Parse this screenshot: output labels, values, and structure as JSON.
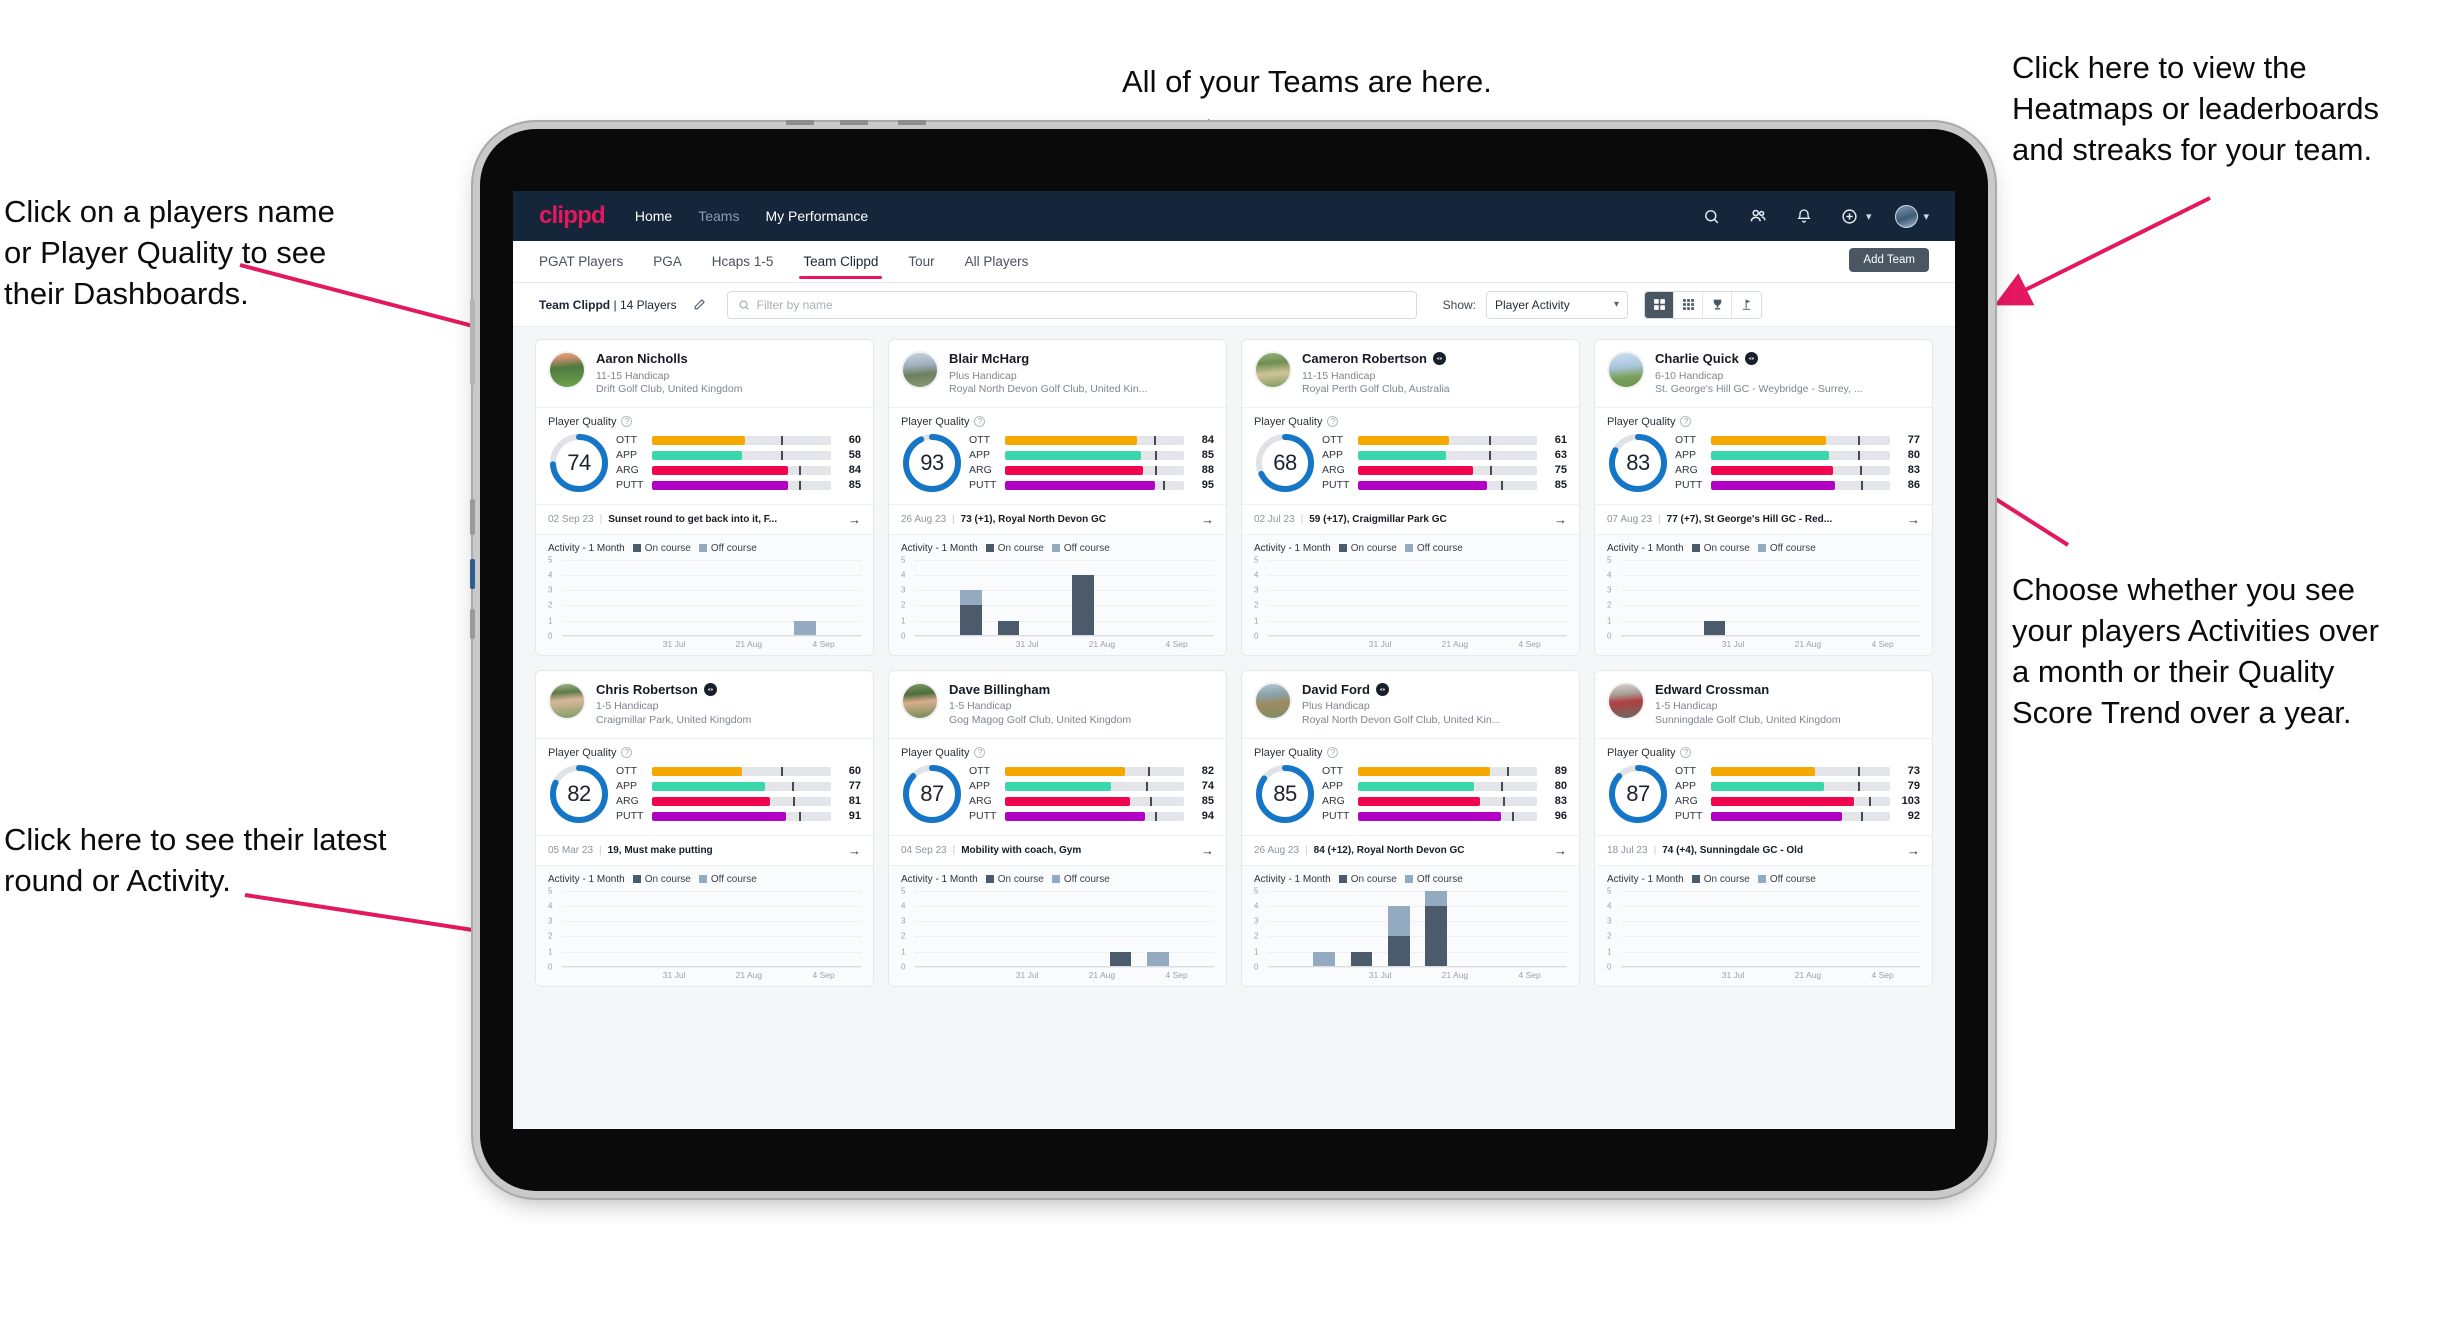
{
  "annotations": [
    {
      "id": "teams",
      "text": "All of your Teams are here."
    },
    {
      "id": "heatmaps",
      "text": "Click here to view the\nHeatmaps or leaderboards\nand streaks for your team."
    },
    {
      "id": "players-name",
      "text": "Click on a players name\nor Player Quality to see\ntheir Dashboards."
    },
    {
      "id": "choose-view",
      "text": "Choose whether you see\nyour players Activities over\na month or their Quality\nScore Trend over a year."
    },
    {
      "id": "latest-round",
      "text": "Click here to see their latest\nround or Activity."
    }
  ],
  "topnav": {
    "brand": "clippd",
    "links": [
      {
        "label": "Home",
        "active": true
      },
      {
        "label": "Teams",
        "active": false
      },
      {
        "label": "My Performance",
        "active": true
      }
    ],
    "icons": [
      "search-icon",
      "people-icon",
      "bell-icon",
      "plus-circle-icon"
    ],
    "avatar": "user-avatar"
  },
  "tabs": [
    {
      "label": "PGAT Players",
      "active": false
    },
    {
      "label": "PGA",
      "active": false
    },
    {
      "label": "Hcaps 1-5",
      "active": false
    },
    {
      "label": "Team Clippd",
      "active": true
    },
    {
      "label": "Tour",
      "active": false
    },
    {
      "label": "All Players",
      "active": false
    }
  ],
  "add_team_label": "Add Team",
  "toolbar": {
    "team_name": "Team Clippd",
    "team_count": "14 Players",
    "separator": "|",
    "edit_icon": "pencil-icon",
    "search_placeholder": "Filter by name",
    "search_value": "",
    "show_label": "Show:",
    "show_value": "Player Activity",
    "views": [
      {
        "name": "card-view-icon",
        "active": true
      },
      {
        "name": "table-view-icon",
        "active": false
      },
      {
        "name": "trophy-view-icon",
        "active": false
      },
      {
        "name": "flag-view-icon",
        "active": false
      }
    ]
  },
  "card_labels": {
    "quality_title": "Player Quality",
    "activity_title": "Activity - 1 Month",
    "legend_on": "On course",
    "legend_off": "Off course",
    "metric_names": [
      "OTT",
      "APP",
      "ARG",
      "PUTT"
    ],
    "x_ticks": [
      "31 Jul",
      "21 Aug",
      "4 Sep"
    ],
    "y_ticks": [
      "5",
      "4",
      "3",
      "2",
      "1",
      "0"
    ]
  },
  "colors": {
    "accent": "#e4185f",
    "navy": "#15263a",
    "ring": "#1575c6",
    "ott": "#f5a800",
    "app": "#3ad6ac",
    "arg": "#f2054f",
    "putt": "#b300c7",
    "on_course": "#4b5b6b",
    "off_course": "#93aac0"
  },
  "players": [
    {
      "name": "Aaron Nicholls",
      "verified": false,
      "avatar": "av1",
      "handicap": "11-15 Handicap",
      "club": "Drift Golf Club, United Kingdom",
      "score": 74,
      "metrics": [
        {
          "label": "OTT",
          "value": 60,
          "fill": 52,
          "tick": 72
        },
        {
          "label": "APP",
          "value": 58,
          "fill": 50,
          "tick": 72
        },
        {
          "label": "ARG",
          "value": 84,
          "fill": 76,
          "tick": 82
        },
        {
          "label": "PUTT",
          "value": 85,
          "fill": 76,
          "tick": 82
        }
      ],
      "latest_date": "02 Sep 23",
      "latest_text": "Sunset round to get back into it, F...",
      "activity": [
        {
          "on": 0,
          "off": 0
        },
        {
          "on": 0,
          "off": 0
        },
        {
          "on": 0,
          "off": 0
        },
        {
          "on": 0,
          "off": 0
        },
        {
          "on": 0,
          "off": 0
        },
        {
          "on": 0,
          "off": 0
        },
        {
          "on": 0,
          "off": 1
        },
        {
          "on": 0,
          "off": 0
        }
      ]
    },
    {
      "name": "Blair McHarg",
      "verified": false,
      "avatar": "av2",
      "handicap": "Plus Handicap",
      "club": "Royal North Devon Golf Club, United Kin...",
      "score": 93,
      "metrics": [
        {
          "label": "OTT",
          "value": 84,
          "fill": 74,
          "tick": 83
        },
        {
          "label": "APP",
          "value": 85,
          "fill": 76,
          "tick": 84
        },
        {
          "label": "ARG",
          "value": 88,
          "fill": 77,
          "tick": 84
        },
        {
          "label": "PUTT",
          "value": 95,
          "fill": 84,
          "tick": 88
        }
      ],
      "latest_date": "26 Aug 23",
      "latest_text": "73 (+1), Royal North Devon GC",
      "activity": [
        {
          "on": 0,
          "off": 0
        },
        {
          "on": 2,
          "off": 1
        },
        {
          "on": 1,
          "off": 0
        },
        {
          "on": 0,
          "off": 0
        },
        {
          "on": 4,
          "off": 0
        },
        {
          "on": 0,
          "off": 0
        },
        {
          "on": 0,
          "off": 0
        },
        {
          "on": 0,
          "off": 0
        }
      ]
    },
    {
      "name": "Cameron Robertson",
      "verified": true,
      "avatar": "av3",
      "handicap": "11-15 Handicap",
      "club": "Royal Perth Golf Club, Australia",
      "score": 68,
      "metrics": [
        {
          "label": "OTT",
          "value": 61,
          "fill": 51,
          "tick": 73
        },
        {
          "label": "APP",
          "value": 63,
          "fill": 49,
          "tick": 73
        },
        {
          "label": "ARG",
          "value": 75,
          "fill": 64,
          "tick": 74
        },
        {
          "label": "PUTT",
          "value": 85,
          "fill": 72,
          "tick": 80
        }
      ],
      "latest_date": "02 Jul 23",
      "latest_text": "59 (+17), Craigmillar Park GC",
      "activity": [
        {
          "on": 0,
          "off": 0
        },
        {
          "on": 0,
          "off": 0
        },
        {
          "on": 0,
          "off": 0
        },
        {
          "on": 0,
          "off": 0
        },
        {
          "on": 0,
          "off": 0
        },
        {
          "on": 0,
          "off": 0
        },
        {
          "on": 0,
          "off": 0
        },
        {
          "on": 0,
          "off": 0
        }
      ]
    },
    {
      "name": "Charlie Quick",
      "verified": true,
      "avatar": "av4",
      "handicap": "6-10 Handicap",
      "club": "St. George's Hill GC - Weybridge - Surrey, ...",
      "score": 83,
      "metrics": [
        {
          "label": "OTT",
          "value": 77,
          "fill": 64,
          "tick": 82
        },
        {
          "label": "APP",
          "value": 80,
          "fill": 66,
          "tick": 82
        },
        {
          "label": "ARG",
          "value": 83,
          "fill": 68,
          "tick": 83
        },
        {
          "label": "PUTT",
          "value": 86,
          "fill": 69,
          "tick": 84
        }
      ],
      "latest_date": "07 Aug 23",
      "latest_text": "77 (+7), St George's Hill GC - Red...",
      "activity": [
        {
          "on": 0,
          "off": 0
        },
        {
          "on": 0,
          "off": 0
        },
        {
          "on": 1,
          "off": 0
        },
        {
          "on": 0,
          "off": 0
        },
        {
          "on": 0,
          "off": 0
        },
        {
          "on": 0,
          "off": 0
        },
        {
          "on": 0,
          "off": 0
        },
        {
          "on": 0,
          "off": 0
        }
      ]
    },
    {
      "name": "Chris Robertson",
      "verified": true,
      "avatar": "av5",
      "handicap": "1-5 Handicap",
      "club": "Craigmillar Park, United Kingdom",
      "score": 82,
      "metrics": [
        {
          "label": "OTT",
          "value": 60,
          "fill": 50,
          "tick": 72
        },
        {
          "label": "APP",
          "value": 77,
          "fill": 63,
          "tick": 78
        },
        {
          "label": "ARG",
          "value": 81,
          "fill": 66,
          "tick": 79
        },
        {
          "label": "PUTT",
          "value": 91,
          "fill": 75,
          "tick": 82
        }
      ],
      "latest_date": "05 Mar 23",
      "latest_text": "19, Must make putting",
      "activity": [
        {
          "on": 0,
          "off": 0
        },
        {
          "on": 0,
          "off": 0
        },
        {
          "on": 0,
          "off": 0
        },
        {
          "on": 0,
          "off": 0
        },
        {
          "on": 0,
          "off": 0
        },
        {
          "on": 0,
          "off": 0
        },
        {
          "on": 0,
          "off": 0
        },
        {
          "on": 0,
          "off": 0
        }
      ]
    },
    {
      "name": "Dave Billingham",
      "verified": false,
      "avatar": "av6",
      "handicap": "1-5 Handicap",
      "club": "Gog Magog Golf Club, United Kingdom",
      "score": 87,
      "metrics": [
        {
          "label": "OTT",
          "value": 82,
          "fill": 67,
          "tick": 80
        },
        {
          "label": "APP",
          "value": 74,
          "fill": 59,
          "tick": 79
        },
        {
          "label": "ARG",
          "value": 85,
          "fill": 70,
          "tick": 81
        },
        {
          "label": "PUTT",
          "value": 94,
          "fill": 78,
          "tick": 84
        }
      ],
      "latest_date": "04 Sep 23",
      "latest_text": "Mobility with coach, Gym",
      "activity": [
        {
          "on": 0,
          "off": 0
        },
        {
          "on": 0,
          "off": 0
        },
        {
          "on": 0,
          "off": 0
        },
        {
          "on": 0,
          "off": 0
        },
        {
          "on": 0,
          "off": 0
        },
        {
          "on": 1,
          "off": 0
        },
        {
          "on": 0,
          "off": 1
        },
        {
          "on": 0,
          "off": 0
        }
      ]
    },
    {
      "name": "David Ford",
      "verified": true,
      "avatar": "av7",
      "handicap": "Plus Handicap",
      "club": "Royal North Devon Golf Club, United Kin...",
      "score": 85,
      "metrics": [
        {
          "label": "OTT",
          "value": 89,
          "fill": 74,
          "tick": 83
        },
        {
          "label": "APP",
          "value": 80,
          "fill": 65,
          "tick": 80
        },
        {
          "label": "ARG",
          "value": 83,
          "fill": 68,
          "tick": 81
        },
        {
          "label": "PUTT",
          "value": 96,
          "fill": 80,
          "tick": 86
        }
      ],
      "latest_date": "26 Aug 23",
      "latest_text": "84 (+12), Royal North Devon GC",
      "activity": [
        {
          "on": 0,
          "off": 0
        },
        {
          "on": 0,
          "off": 1
        },
        {
          "on": 1,
          "off": 0
        },
        {
          "on": 2,
          "off": 2
        },
        {
          "on": 4,
          "off": 1
        },
        {
          "on": 0,
          "off": 0
        },
        {
          "on": 0,
          "off": 0
        },
        {
          "on": 0,
          "off": 0
        }
      ]
    },
    {
      "name": "Edward Crossman",
      "verified": false,
      "avatar": "av8",
      "handicap": "1-5 Handicap",
      "club": "Sunningdale Golf Club, United Kingdom",
      "score": 87,
      "metrics": [
        {
          "label": "OTT",
          "value": 73,
          "fill": 58,
          "tick": 82
        },
        {
          "label": "APP",
          "value": 79,
          "fill": 63,
          "tick": 82
        },
        {
          "label": "ARG",
          "value": 103,
          "fill": 80,
          "tick": 88
        },
        {
          "label": "PUTT",
          "value": 92,
          "fill": 73,
          "tick": 84
        }
      ],
      "latest_date": "18 Jul 23",
      "latest_text": "74 (+4), Sunningdale GC - Old",
      "activity": [
        {
          "on": 0,
          "off": 0
        },
        {
          "on": 0,
          "off": 0
        },
        {
          "on": 0,
          "off": 0
        },
        {
          "on": 0,
          "off": 0
        },
        {
          "on": 0,
          "off": 0
        },
        {
          "on": 0,
          "off": 0
        },
        {
          "on": 0,
          "off": 0
        },
        {
          "on": 0,
          "off": 0
        }
      ]
    }
  ]
}
